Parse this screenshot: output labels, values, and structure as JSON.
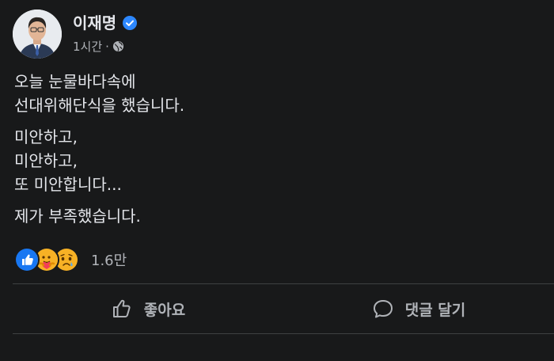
{
  "post": {
    "author": "이재명",
    "time": "1시간",
    "separator": "·",
    "paragraphs": [
      [
        "오늘 눈물바다속에",
        "선대위해단식을 했습니다."
      ],
      [
        "미안하고,",
        "미안하고,",
        "또 미안합니다..."
      ],
      [
        "제가 부족했습니다."
      ]
    ],
    "reactions": {
      "icons": [
        "like-icon",
        "care-icon",
        "sad-icon"
      ],
      "count": "1.6만"
    },
    "actions": {
      "like_label": "좋아요",
      "comment_label": "댓글 달기"
    }
  },
  "colors": {
    "background": "#18191a",
    "text_primary": "#e4e6eb",
    "text_secondary": "#b0b3b8",
    "verified_blue": "#2d88ff",
    "like_blue": "#1877f2",
    "divider": "#3e4042"
  }
}
